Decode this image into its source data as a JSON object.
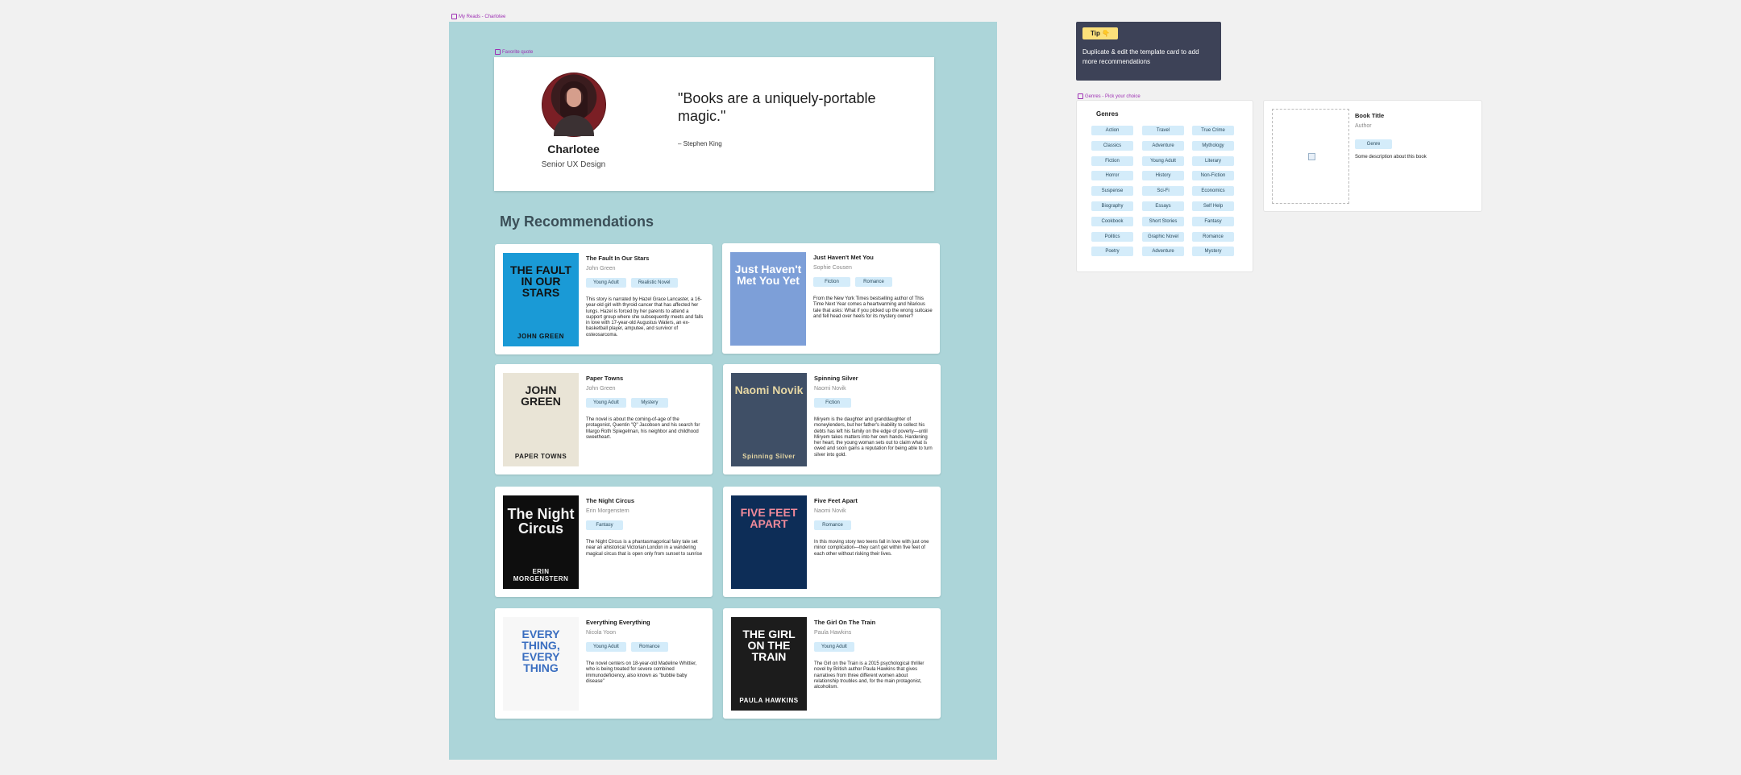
{
  "frames": {
    "board_label": "My Reads - Charlotee",
    "profile_label": "Favorite quote",
    "genres_label": "Genres - Pick your choice"
  },
  "profile": {
    "name": "Charlotee",
    "role": "Senior UX Design",
    "quote": "\"Books are a uniquely-portable magic.\"",
    "quote_author": "– Stephen King"
  },
  "recommendations_title": "My Recommendations",
  "books": [
    {
      "title": "The Fault In Our Stars",
      "author": "John Green",
      "tags": [
        "Young Adult",
        "Realistic Novel"
      ],
      "desc": "This story is narrated by Hazel Grace Lancaster, a 16-year-old girl with thyroid cancer that has affected her lungs. Hazel is forced by her parents to attend a support group where she subsequently meets and falls in love with 17-year-old Augustus Waters, an ex-basketball player, amputee, and survivor of osteosarcoma.",
      "cover_text": "THE FAULT IN OUR STARS",
      "cover_author": "JOHN GREEN",
      "cover_bg": "#1a9ad6",
      "cover_fg": "#111111"
    },
    {
      "title": "Just Haven't Met You",
      "author": "Sophie Cousen",
      "tags": [
        "Fiction",
        "Romance"
      ],
      "desc": "From the New York Times bestselling author of This Time Next Year comes a heartwarming and hilarious tale that asks: What if you picked up the wrong suitcase and fell head over heels for its mystery owner?",
      "cover_text": "Just Haven't Met You Yet",
      "cover_author": "",
      "cover_bg": "#7d9fd8",
      "cover_fg": "#ffffff"
    },
    {
      "title": "Paper Towns",
      "author": "John Green",
      "tags": [
        "Young Adult",
        "Mystery"
      ],
      "desc": "The novel is about the coming-of-age of the protagonist, Quentin \"Q\" Jacobsen and his search for Margo Roth Spiegelman, his neighbor and childhood sweetheart.",
      "cover_text": "JOHN GREEN",
      "cover_author": "PAPER TOWNS",
      "cover_bg": "#e9e4d6",
      "cover_fg": "#1d1d1d"
    },
    {
      "title": "Spinning Silver",
      "author": "Naomi Novik",
      "tags": [
        "Fiction"
      ],
      "desc": "Miryem is the daughter and granddaughter of moneylenders, but her father's inability to collect his debts has left his family on the edge of poverty—until Miryem takes matters into her own hands. Hardening her heart, the young woman sets out to claim what is owed and soon gains a reputation for being able to turn silver into gold.",
      "cover_text": "Naomi Novik",
      "cover_author": "Spinning Silver",
      "cover_bg": "#3f4f66",
      "cover_fg": "#e6d7a4"
    },
    {
      "title": "The Night Circus",
      "author": "Erin Morgenstern",
      "tags": [
        "Fantasy"
      ],
      "desc": "The Night Circus is a phantasmagorical fairy tale set near an ahistorical Victorian London in a wandering magical circus that is open only from sunset to sunrise",
      "cover_text": "The Night Circus",
      "cover_author": "ERIN MORGENSTERN",
      "cover_bg": "#0e0e0e",
      "cover_fg": "#f2f2f2"
    },
    {
      "title": "Five Feet Apart",
      "author": "Naomi Novik",
      "tags": [
        "Romance"
      ],
      "desc": "In this moving story two teens fall in love with just one minor complication—they can't get within five feet of each other without risking their lives.",
      "cover_text": "FIVE FEET APART",
      "cover_author": "",
      "cover_bg": "#0d2d57",
      "cover_fg": "#f08a9a"
    },
    {
      "title": "Everything Everything",
      "author": "Nicola Yoon",
      "tags": [
        "Young Adult",
        "Romance"
      ],
      "desc": "The novel centers on 18-year-old Madeline Whittier, who is being treated for severe combined immunodeficiency, also known as \"bubble baby disease\"",
      "cover_text": "EVERY THING, EVERY THING",
      "cover_author": "",
      "cover_bg": "#f7f7f7",
      "cover_fg": "#3a6ec0"
    },
    {
      "title": "The Girl On The Train",
      "author": "Paula Hawkins",
      "tags": [
        "Young Adult"
      ],
      "desc": "The Girl on the Train is a 2015 psychological thriller novel by British author Paula Hawkins that gives narratives from three different women about relationship troubles and, for the main protagonist, alcoholism.",
      "cover_text": "THE GIRL ON THE TRAIN",
      "cover_author": "PAULA HAWKINS",
      "cover_bg": "#1c1c1c",
      "cover_fg": "#ffffff"
    }
  ],
  "tip": {
    "badge": "Tip 👇",
    "text": "Duplicate & edit the template card to add more recommendations"
  },
  "genres": {
    "title": "Genres",
    "columns": [
      [
        "Action",
        "Classics",
        "Fiction",
        "Horror",
        "Suspense",
        "Biography",
        "Cookbook",
        "Politics",
        "Poetry"
      ],
      [
        "Travel",
        "Adventure",
        "Young Adult",
        "History",
        "Sci-Fi",
        "Essays",
        "Short Stories",
        "Graphic Novel",
        "Adventure"
      ],
      [
        "True Crime",
        "Mythology",
        "Literary",
        "Non-Fiction",
        "Economics",
        "Self Help",
        "Fantasy",
        "Romance",
        "Mystery"
      ]
    ]
  },
  "template_card": {
    "title": "Book Title",
    "author": "Author",
    "tag": "Genre",
    "desc": "Some description about this book"
  },
  "colors": {
    "board": "#acd5d9",
    "tag": "#d4ecfa",
    "tip_bg": "#3d4257",
    "tip_badge": "#fbe07a",
    "frame_label": "#9d2fb3"
  }
}
